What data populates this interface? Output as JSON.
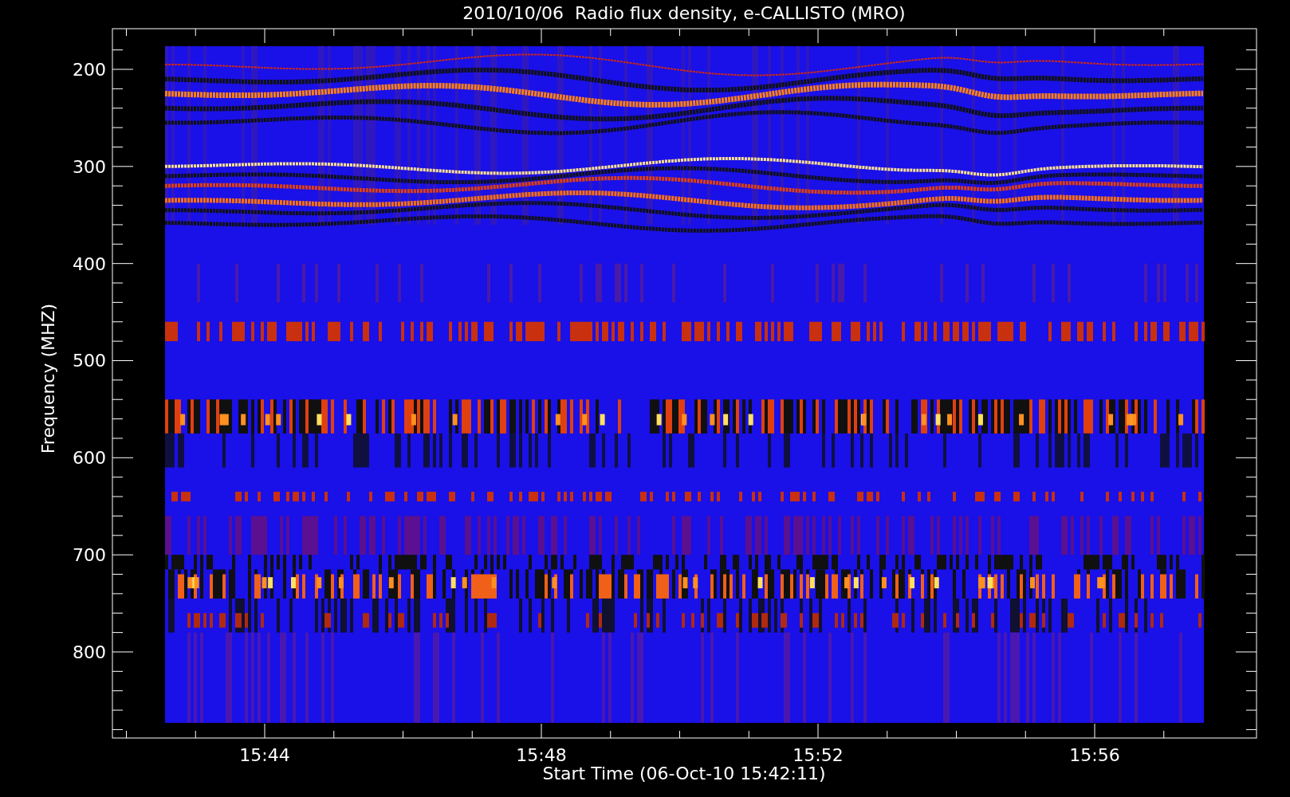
{
  "title": "2010/10/06  Radio flux density, e-CALLISTO (MRO)",
  "x_axis": {
    "label": "Start Time (06-Oct-10 15:42:11)",
    "ticks": [
      "15:44",
      "15:48",
      "15:52",
      "15:56"
    ]
  },
  "y_axis": {
    "label": "Frequency (MHZ)",
    "ticks": [
      "200",
      "300",
      "400",
      "500",
      "600",
      "700",
      "800"
    ]
  }
}
